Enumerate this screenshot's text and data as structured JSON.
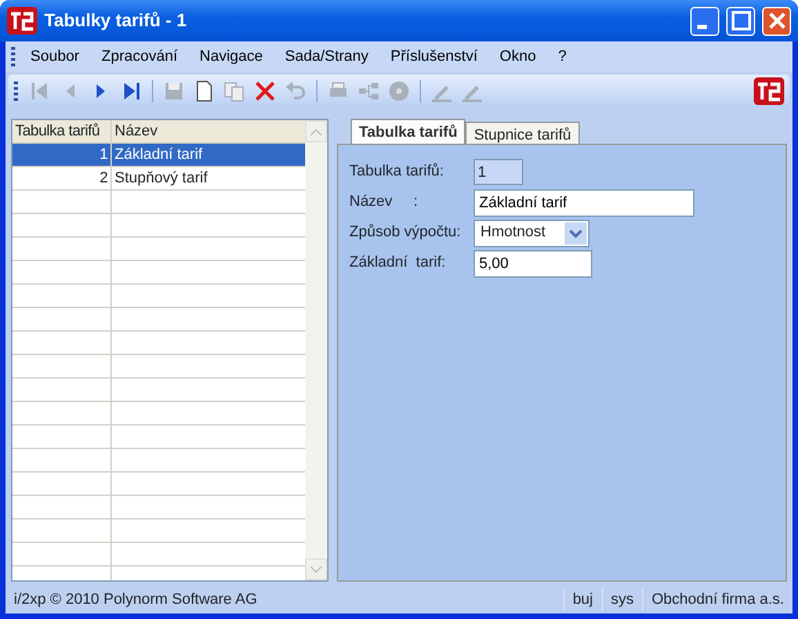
{
  "window": {
    "title": "Tabulky tarifů - 1"
  },
  "menu": [
    "Soubor",
    "Zpracování",
    "Navigace",
    "Sada/Strany",
    "Příslušenství",
    "Okno",
    "?"
  ],
  "toolbar": [
    {
      "kind": "first",
      "disabled": true
    },
    {
      "kind": "prev",
      "disabled": true
    },
    {
      "kind": "next",
      "disabled": false
    },
    {
      "kind": "last",
      "disabled": false
    },
    {
      "kind": "sep"
    },
    {
      "kind": "save",
      "disabled": true
    },
    {
      "kind": "new",
      "disabled": false
    },
    {
      "kind": "copy",
      "disabled": true
    },
    {
      "kind": "delete",
      "disabled": false
    },
    {
      "kind": "undo",
      "disabled": true
    },
    {
      "kind": "sep"
    },
    {
      "kind": "print",
      "disabled": true
    },
    {
      "kind": "tree",
      "disabled": true
    },
    {
      "kind": "disc",
      "disabled": true
    },
    {
      "kind": "sep"
    },
    {
      "kind": "edit",
      "disabled": true
    },
    {
      "kind": "edit",
      "disabled": true
    }
  ],
  "table": {
    "columns": [
      "Tabulka tarifů",
      "Název"
    ],
    "rows": [
      {
        "cells": [
          "1",
          "Základní tarif"
        ],
        "selected": true
      },
      {
        "cells": [
          "2",
          "Stupňový tarif"
        ],
        "selected": false
      }
    ]
  },
  "tabs": [
    {
      "label": "Tabulka tarifů",
      "selected": true
    },
    {
      "label": "Stupnice tarifů",
      "selected": false
    }
  ],
  "form": [
    {
      "kind": "readonly",
      "label": "Tabulka tarifů:",
      "value": "1"
    },
    {
      "kind": "text",
      "label": "Název     :",
      "value": "Základní tarif"
    },
    {
      "kind": "select",
      "label": "Způsob výpočtu:",
      "value": "Hmotnost"
    },
    {
      "kind": "text",
      "label": "Základní  tarif:",
      "value": "5,00"
    }
  ],
  "status_bar": [
    "i/2xp © 2010 Polynorm Software AG",
    "buj",
    "sys",
    "Obchodní firma a.s."
  ]
}
